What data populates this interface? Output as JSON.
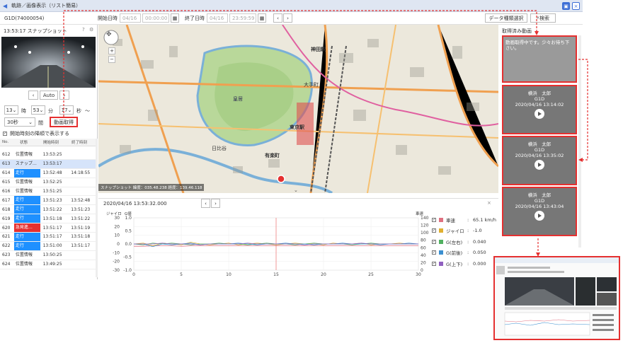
{
  "window": {
    "title": "軌跡／画像表示（リスト簡易）"
  },
  "toolbar": {
    "vehicle": "G1D(74000054)",
    "start_label": "開始日時",
    "start_date": "04/16",
    "start_time": "00:00:00",
    "end_label": "終了日時",
    "end_date": "04/16",
    "end_time": "23:59:59",
    "select_label": "データ種類選択",
    "search_label": "検索"
  },
  "snapshot": {
    "title": "13:53:17 スナップショット",
    "auto_label": "Auto"
  },
  "time_controls": {
    "hour": "13",
    "hour_unit": "時",
    "minute": "53",
    "minute_unit": "分",
    "second": "17",
    "second_unit": "秒",
    "tilde": "～",
    "interval": "30秒",
    "interval_unit": "間",
    "fetch_label": "動画取得",
    "checkbox_label": "開始時刻の降順で表示する"
  },
  "table": {
    "headers": [
      "No.",
      "状態",
      "開始時刻",
      "終了時刻"
    ],
    "rows": [
      {
        "no": "612",
        "status": "位置情報",
        "start": "13:53:25",
        "end": "",
        "kind": "none"
      },
      {
        "no": "613",
        "status": "スナップ…",
        "start": "13:53:17",
        "end": "",
        "kind": "selected"
      },
      {
        "no": "614",
        "status": "走行",
        "start": "13:52:48",
        "end": "14:18:55",
        "kind": "blue"
      },
      {
        "no": "615",
        "status": "位置情報",
        "start": "13:52:25",
        "end": "",
        "kind": "none"
      },
      {
        "no": "616",
        "status": "位置情報",
        "start": "13:51:25",
        "end": "",
        "kind": "none"
      },
      {
        "no": "617",
        "status": "走行",
        "start": "13:51:23",
        "end": "13:52:48",
        "kind": "blue"
      },
      {
        "no": "618",
        "status": "走行",
        "start": "13:51:22",
        "end": "13:51:23",
        "kind": "blue"
      },
      {
        "no": "619",
        "status": "走行",
        "start": "13:51:18",
        "end": "13:51:22",
        "kind": "blue"
      },
      {
        "no": "620",
        "status": "急発進…",
        "start": "13:51:17",
        "end": "13:51:19",
        "kind": "red"
      },
      {
        "no": "621",
        "status": "走行",
        "start": "13:51:17",
        "end": "13:51:18",
        "kind": "blue"
      },
      {
        "no": "622",
        "status": "走行",
        "start": "13:51:00",
        "end": "13:51:17",
        "kind": "blue"
      },
      {
        "no": "623",
        "status": "位置情報",
        "start": "13:50:25",
        "end": "",
        "kind": "none"
      },
      {
        "no": "624",
        "status": "位置情報",
        "start": "13:49:25",
        "end": "",
        "kind": "none"
      }
    ]
  },
  "map": {
    "labels": [
      "神田駅",
      "東京駅",
      "有楽町",
      "皇居",
      "日比谷",
      "大手町"
    ],
    "status": "スナップショット 緯度：035.48.238 経度：139.46.118"
  },
  "chart_panel": {
    "timestamp": "2020/04/16 13:53:32.000",
    "left_axis_title_1": "ジャイロ",
    "left_axis_title_2": "G値",
    "right_axis_title": "車速"
  },
  "chart_data": {
    "type": "line",
    "x": [
      0,
      1,
      2,
      3,
      4,
      5,
      6,
      7,
      8,
      9,
      10,
      11,
      12,
      13,
      14,
      15,
      16,
      17,
      18,
      19,
      20,
      21,
      22,
      23,
      24,
      25,
      26,
      27,
      28,
      29,
      30
    ],
    "xticks": [
      "0",
      "5",
      "10",
      "15",
      "20",
      "25",
      "30"
    ],
    "yticks_gyro": [
      "30",
      "20",
      "10",
      "0",
      "-10",
      "-20",
      "-30"
    ],
    "yticks_g": [
      "1.0",
      "0.5",
      "0.0",
      "-0.5",
      "-1.0"
    ],
    "yticks_speed": [
      "140",
      "120",
      "100",
      "80",
      "60",
      "40",
      "20",
      "0"
    ],
    "ylim_gyro": [
      -30,
      30
    ],
    "ylim_speed": [
      0,
      140
    ],
    "marker_x": 15,
    "series": [
      {
        "name": "車速",
        "value_text": "65.1 km/h",
        "color": "#e07080",
        "axis": "speed",
        "values": [
          64,
          64,
          65,
          65,
          65,
          64,
          65,
          65,
          65,
          65,
          65,
          65,
          65,
          65,
          65,
          65,
          65,
          65,
          65,
          65,
          65,
          65,
          65,
          65,
          65,
          65,
          65,
          65,
          65,
          65,
          65
        ]
      },
      {
        "name": "ジャイロ",
        "value_text": "-1.0",
        "color": "#e0b030",
        "axis": "gyro",
        "values": [
          0,
          1,
          -2,
          1,
          0,
          -1,
          2,
          0,
          -1,
          0,
          1,
          -1,
          0,
          1,
          0,
          -1,
          0,
          1,
          0,
          0,
          -1,
          1,
          0,
          0,
          1,
          -1,
          0,
          0,
          1,
          0,
          0
        ]
      },
      {
        "name": "G(左右)",
        "value_text": "0.040",
        "color": "#50b060",
        "axis": "gyro",
        "values": [
          0,
          -1,
          1,
          0,
          1,
          0,
          -1,
          0,
          0,
          1,
          0,
          0,
          -1,
          0,
          1,
          0,
          0,
          -1,
          0,
          1,
          0,
          0,
          0,
          -1,
          0,
          1,
          0,
          0,
          0,
          0,
          0
        ]
      },
      {
        "name": "G(前後)",
        "value_text": "0.050",
        "color": "#3a8fd0",
        "axis": "gyro",
        "values": [
          0,
          0,
          -3,
          0,
          -1,
          0,
          1,
          -1,
          0,
          0,
          0,
          1,
          0,
          -1,
          0,
          0,
          1,
          0,
          0,
          -1,
          0,
          0,
          1,
          0,
          0,
          0,
          -1,
          0,
          0,
          1,
          0
        ]
      },
      {
        "name": "G(上下)",
        "value_text": "0.000",
        "color": "#9060c0",
        "axis": "gyro",
        "values": [
          0,
          0,
          0,
          1,
          0,
          0,
          0,
          -1,
          0,
          0,
          0,
          0,
          1,
          0,
          0,
          0,
          0,
          0,
          -1,
          0,
          0,
          0,
          0,
          0,
          1,
          0,
          0,
          0,
          0,
          0,
          0
        ]
      }
    ]
  },
  "videos": {
    "title": "取得済み動画",
    "loading": "動画取得中です。少々お待ち下さい。",
    "items": [
      {
        "name": "横浜　太郎",
        "vehicle": "G1D",
        "time": "2020/04/16 13:14:02"
      },
      {
        "name": "横浜　太郎",
        "vehicle": "G1D",
        "time": "2020/04/16 13:35:02"
      },
      {
        "name": "横浜　太郎",
        "vehicle": "G1D",
        "time": "2020/04/16 13:43:04"
      }
    ]
  },
  "colors": {
    "accent": "#3d6fd6",
    "highlight": "#e53030",
    "status_blue": "#1e90ff",
    "status_red": "#e53030"
  }
}
